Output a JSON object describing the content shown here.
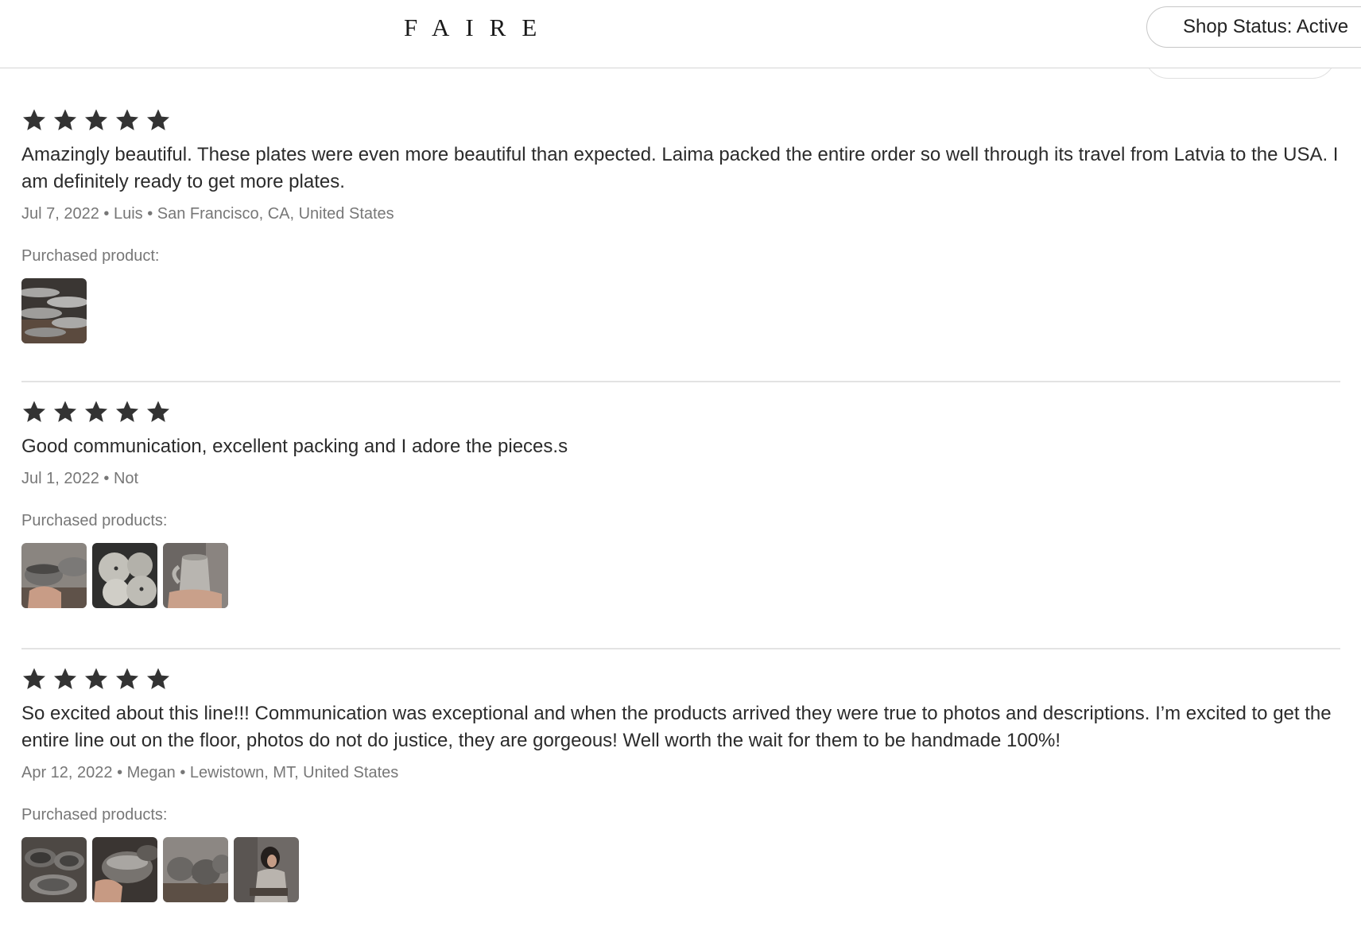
{
  "header": {
    "logo": "FAIRE",
    "shop_status": "Shop Status: Active"
  },
  "reviews": [
    {
      "rating": 5,
      "text": "Amazingly beautiful. These plates were even more beautiful than expected. Laima packed the entire order so well through its travel from Latvia to the USA. I am definitely ready to get more plates.",
      "meta": "Jul 7, 2022 • Luis • San Francisco, CA, United States",
      "purchased_label": "Purchased product:",
      "products": [
        "oval-plates-photo"
      ]
    },
    {
      "rating": 5,
      "text": "Good communication, excellent packing and I adore the pieces.s",
      "meta": "Jul 1, 2022 • Not",
      "purchased_label": "Purchased products:",
      "products": [
        "bowl-in-hand-photo",
        "round-vases-photo",
        "pitcher-photo"
      ]
    },
    {
      "rating": 5,
      "text": "So excited about this line!!! Communication was exceptional and when the products arrived they were true to photos and descriptions. I’m excited to get the entire line out on the floor, photos do not do justice, they are gorgeous! Well worth the wait for them to be handmade 100%!",
      "meta": "Apr 12, 2022 • Megan • Lewistown, MT, United States",
      "purchased_label": "Purchased products:",
      "products": [
        "plate-set-photo",
        "bowl-held-photo",
        "mugs-photo",
        "potter-at-work-photo"
      ]
    }
  ],
  "colors": {
    "star": "#333333",
    "divider": "#e3e3e3",
    "meta_text": "#777777"
  }
}
